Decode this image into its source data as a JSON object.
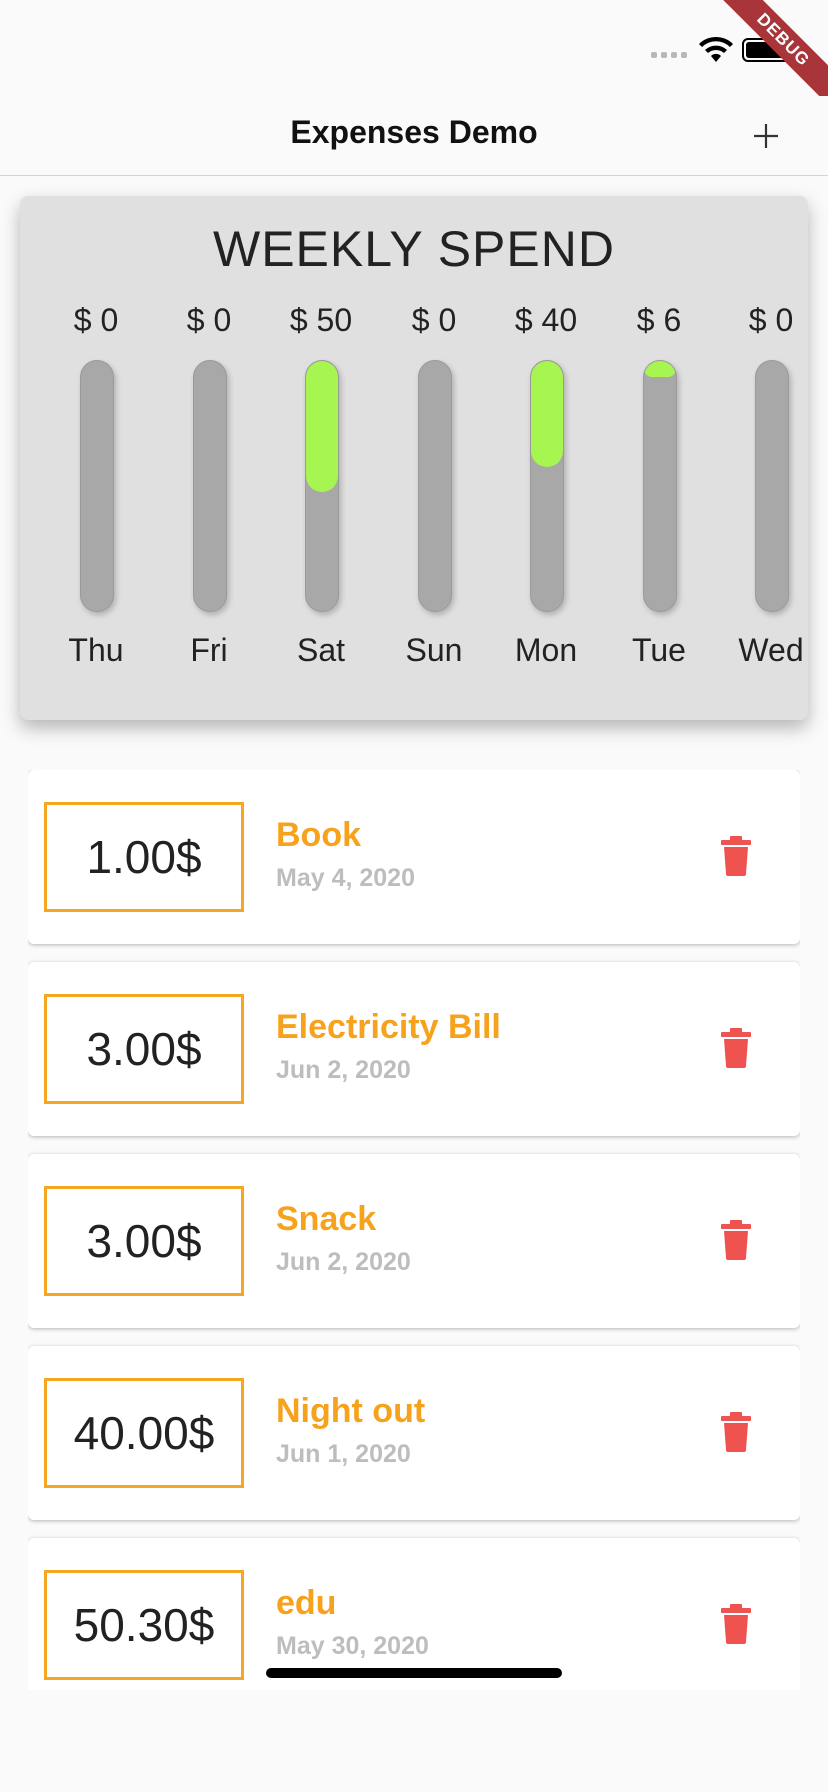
{
  "status_bar": {
    "debug_label": "DEBUG"
  },
  "app_bar": {
    "title": "Expenses Demo",
    "add_icon": "plus-icon"
  },
  "chart": {
    "title": "WEEKLY SPEND",
    "bar_color": "#a6f550",
    "track_color": "#a8a8a8"
  },
  "chart_data": {
    "type": "bar",
    "title": "WEEKLY SPEND",
    "categories": [
      "Thu",
      "Fri",
      "Sat",
      "Sun",
      "Mon",
      "Tue",
      "Wed"
    ],
    "values": [
      0,
      0,
      50,
      0,
      40,
      6,
      0
    ],
    "value_labels": [
      "$ 0",
      "$ 0",
      "$ 50",
      "$ 0",
      "$ 40",
      "$ 6",
      "$ 0"
    ],
    "fill_fractions": [
      0,
      0,
      0.52,
      0,
      0.42,
      0.06,
      0
    ]
  },
  "expenses": [
    {
      "amount": "1.00$",
      "title": "Book",
      "date": "May 4, 2020"
    },
    {
      "amount": "3.00$",
      "title": "Electricity Bill",
      "date": "Jun 2, 2020"
    },
    {
      "amount": "3.00$",
      "title": "Snack",
      "date": "Jun 2, 2020"
    },
    {
      "amount": "40.00$",
      "title": "Night out",
      "date": "Jun 1, 2020"
    },
    {
      "amount": "50.30$",
      "title": "edu",
      "date": "May 30, 2020"
    }
  ],
  "colors": {
    "accent": "#f7a21c",
    "delete": "#ef5350",
    "date_text": "#bdbdbd"
  },
  "icons": {
    "delete": "trash-icon"
  }
}
